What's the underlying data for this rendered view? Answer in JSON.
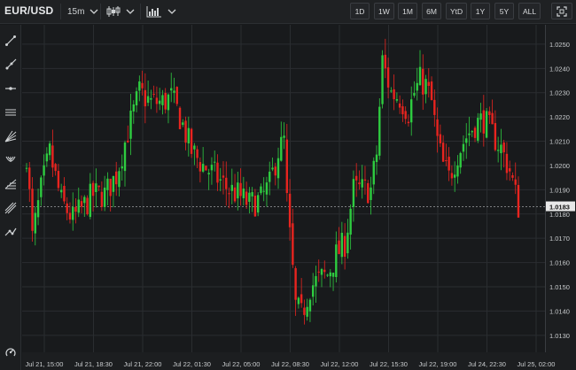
{
  "header": {
    "symbol": "EUR/USD",
    "interval": "15m",
    "chart_style": "candlestick-icon",
    "compare": "bar-chart-icon",
    "ranges": [
      "1D",
      "1W",
      "1M",
      "6M",
      "YtD",
      "1Y",
      "5Y",
      "ALL"
    ]
  },
  "toolbar": {
    "tools": [
      "trend-line-icon",
      "ray-icon",
      "horizontal-line-icon",
      "parallel-channel-icon",
      "fib-fan-icon",
      "pitchfork-icon",
      "fib-retracement-icon",
      "gann-icon",
      "measure-icon",
      "settings-icon"
    ]
  },
  "colors": {
    "up": "#2ecc40",
    "down": "#e8241f",
    "background": "#181a1c",
    "grid": "#2a2d30",
    "last_price_line": "#8a8d90",
    "last_price_badge": "#e8e8e8"
  },
  "chart_data": {
    "type": "candlestick",
    "symbol": "EUR/USD",
    "interval": "15m",
    "ylim": [
      1.0123,
      1.0258
    ],
    "y_ticks": [
      "1.0250",
      "1.0240",
      "1.0230",
      "1.0220",
      "1.0210",
      "1.0200",
      "1.0190",
      "1.0183",
      "1.0180",
      "1.0170",
      "1.0160",
      "1.0150",
      "1.0140",
      "1.0130"
    ],
    "x_tick_labels": [
      "Jul 21, 15:00",
      "Jul 21, 18:30",
      "Jul 21, 22:00",
      "Jul 22, 01:30",
      "Jul 22, 05:00",
      "Jul 22, 08:30",
      "Jul 22, 12:00",
      "Jul 22, 15:30",
      "Jul 22, 19:00",
      "Jul 24, 22:30",
      "Jul 25, 02:00"
    ],
    "last_price": 1.0183,
    "grid": true,
    "path_waypoints": [
      [
        0,
        1.0205
      ],
      [
        2,
        1.017
      ],
      [
        5,
        1.019
      ],
      [
        8,
        1.0205
      ],
      [
        12,
        1.0185
      ],
      [
        16,
        1.0178
      ],
      [
        19,
        1.0182
      ],
      [
        23,
        1.0188
      ],
      [
        27,
        1.0188
      ],
      [
        31,
        1.0196
      ],
      [
        35,
        1.0214
      ],
      [
        39,
        1.023
      ],
      [
        43,
        1.0226
      ],
      [
        47,
        1.0226
      ],
      [
        50,
        1.0228
      ],
      [
        53,
        1.022
      ],
      [
        57,
        1.0206
      ],
      [
        61,
        1.02
      ],
      [
        65,
        1.0196
      ],
      [
        69,
        1.0191
      ],
      [
        73,
        1.0188
      ],
      [
        77,
        1.0184
      ],
      [
        81,
        1.0186
      ],
      [
        84,
        1.0192
      ],
      [
        87,
        1.0206
      ],
      [
        89,
        1.021
      ],
      [
        90,
        1.0185
      ],
      [
        93,
        1.0142
      ],
      [
        95,
        1.0138
      ],
      [
        98,
        1.015
      ],
      [
        101,
        1.0153
      ],
      [
        104,
        1.0155
      ],
      [
        107,
        1.0163
      ],
      [
        110,
        1.0168
      ],
      [
        113,
        1.019
      ],
      [
        116,
        1.019
      ],
      [
        119,
        1.019
      ],
      [
        121,
        1.0205
      ],
      [
        123,
        1.0243
      ],
      [
        126,
        1.023
      ],
      [
        129,
        1.0228
      ],
      [
        132,
        1.0222
      ],
      [
        134,
        1.023
      ],
      [
        136,
        1.0235
      ],
      [
        138,
        1.0233
      ],
      [
        140,
        1.0226
      ],
      [
        142,
        1.021
      ],
      [
        144,
        1.02
      ],
      [
        146,
        1.0195
      ],
      [
        149,
        1.0205
      ],
      [
        152,
        1.0212
      ],
      [
        155,
        1.0217
      ],
      [
        158,
        1.0219
      ],
      [
        161,
        1.0213
      ],
      [
        164,
        1.0207
      ],
      [
        167,
        1.0198
      ],
      [
        170,
        1.0183
      ]
    ]
  }
}
